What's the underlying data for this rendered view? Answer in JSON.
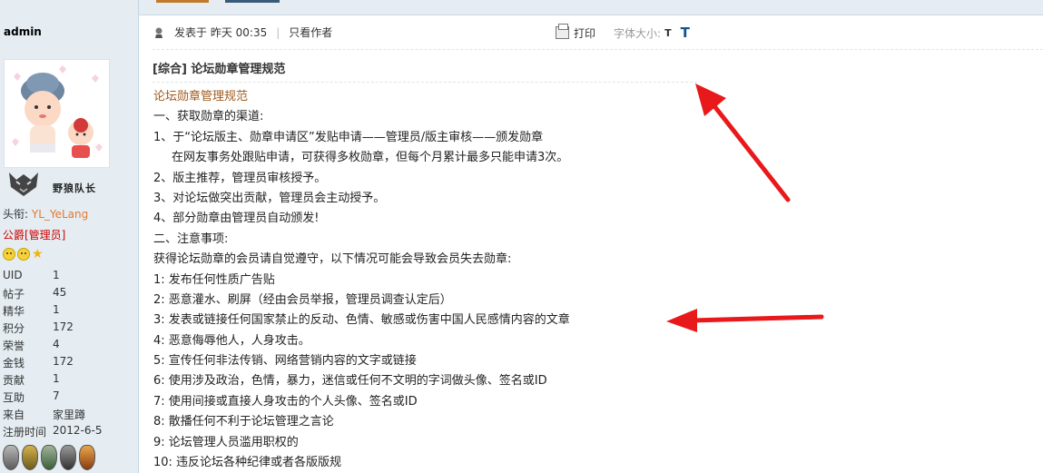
{
  "sidebar": {
    "username": "admin",
    "rank_text": "野狼队长",
    "title_label": "头衔: ",
    "title_value": "YL_YeLang",
    "group": "公爵[管理员]",
    "stats": [
      {
        "key": "UID",
        "value": "1"
      },
      {
        "key": "帖子",
        "value": "45"
      },
      {
        "key": "精华",
        "value": "1"
      },
      {
        "key": "积分",
        "value": "172"
      },
      {
        "key": "荣誉",
        "value": "4"
      },
      {
        "key": "金钱",
        "value": "172"
      },
      {
        "key": "贡献",
        "value": "1"
      },
      {
        "key": "互助",
        "value": "7"
      },
      {
        "key": "来自",
        "value": "家里蹲"
      },
      {
        "key": "注册时间",
        "value": "2012-6-5"
      }
    ]
  },
  "post": {
    "posted_at": "发表于 昨天 00:35",
    "only_author": "只看作者",
    "print": "打印",
    "font_size": "字体大小:",
    "font_small": "T",
    "font_large": "T",
    "title": "[综合] 论坛勋章管理规范",
    "lines": [
      "论坛勋章管理规范",
      "一、获取勋章的渠道:",
      "1、于“论坛版主、勋章申请区”发贴申请——管理员/版主审核——颁发勋章",
      "在网友事务处跟贴申请，可获得多枚勋章，但每个月累计最多只能申请3次。",
      "2、版主推荐，管理员审核授予。",
      "3、对论坛做突出贡献，管理员会主动授予。",
      "4、部分勋章由管理员自动颁发!",
      "二、注意事项:",
      "获得论坛勋章的会员请自觉遵守，以下情况可能会导致会员失去勋章:",
      "1: 发布任何性质广告贴",
      "2: 恶意灌水、刷屏（经由会员举报，管理员调查认定后）",
      "3: 发表或链接任何国家禁止的反动、色情、敏感或伤害中国人民感情内容的文章",
      "4: 恶意侮辱他人，人身攻击。",
      "5: 宣传任何非法传销、网络营销内容的文字或链接",
      "6: 使用涉及政治，色情，暴力，迷信或任何不文明的字词做头像、签名或ID",
      "7: 使用间接或直接人身攻击的个人头像、签名或ID",
      "8:  散播任何不利于论坛管理之言论",
      "9:  论坛管理人员滥用职权的",
      "10: 违反论坛各种纪律或者各版版规"
    ]
  },
  "colors": {
    "sidebar_bg": "#e5edf2",
    "title_value": "#e4792d",
    "group": "#cc0000",
    "first_line": "#a05a1d",
    "arrow": "#e8191b"
  },
  "icons": [
    "post-status-icon",
    "print-icon",
    "smiley-icon",
    "star-icon",
    "medal-icon"
  ]
}
